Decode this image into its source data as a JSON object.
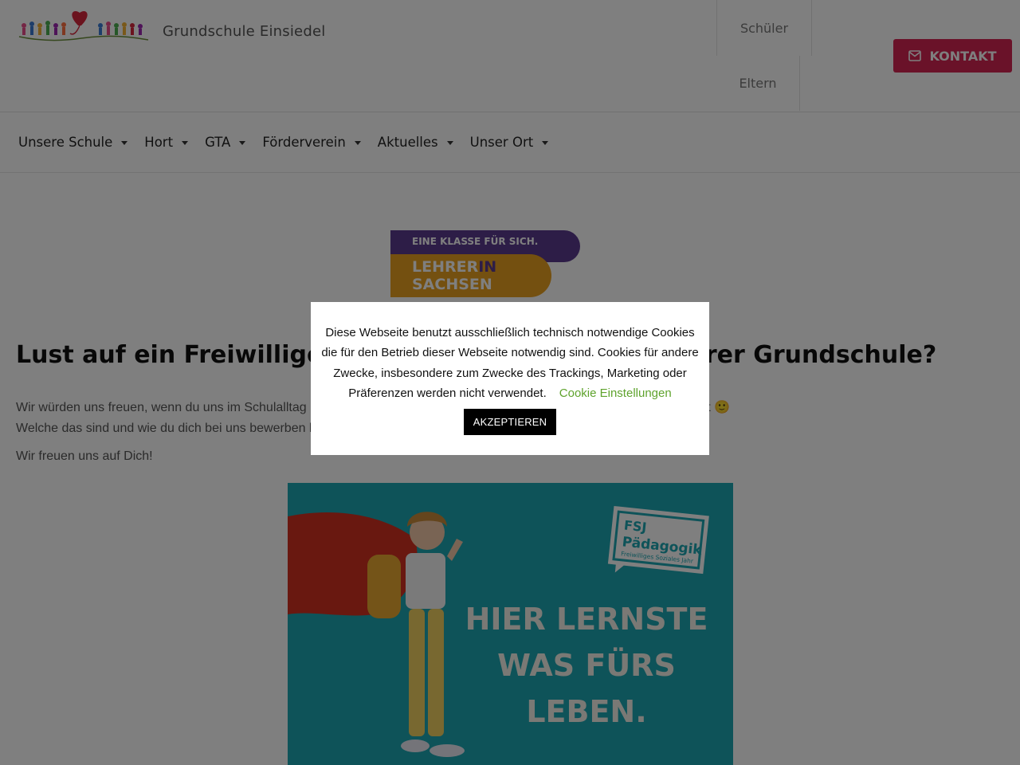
{
  "header": {
    "site_title": "Grundschule Einsiedel",
    "top_links": {
      "schueler": "Schüler",
      "eltern": "Eltern"
    },
    "kontakt_label": "KONTAKT"
  },
  "nav": {
    "items": [
      "Unsere Schule",
      "Hort",
      "GTA",
      "Förderverein",
      "Aktuelles",
      "Unser Ort"
    ]
  },
  "banner": {
    "line1": "EINE KLASSE FÜR SICH.",
    "line2a": "LEHRER",
    "line2b": "IN",
    "line3": "SACHSEN"
  },
  "content": {
    "headline": "Lust auf ein Freiwilliges Soziales Jahr (FSJ) an unserer Grundschule?",
    "para1_line1": "Wir würden uns freuen, wenn du uns im Schulalltag unterstützt. Es gibt verschiedene Aufgaben, die du übernehmen kannst 🙂",
    "para1_line2": "Welche das sind und wie du dich bei uns bewerben kannst, erfährst du unten.",
    "para2": "Wir freuen uns auf Dich!"
  },
  "poster": {
    "badge_line1": "FSJ",
    "badge_line2": "Pädagogik",
    "badge_line3": "Freiwilliges Soziales Jahr",
    "slogan_line1": "HIER LERNSTE",
    "slogan_line2": "WAS FÜRS",
    "slogan_line3": "LEBEN."
  },
  "cookie": {
    "text": "Diese Webseite benutzt ausschließlich technisch notwendige Cookies die für den Betrieb dieser Webseite notwendig sind. Cookies für andere Zwecke, insbesondere zum Zwecke des Trackings, Marketing oder Präferenzen werden nicht verwendet.",
    "settings_link": "Cookie Einstellungen",
    "accept_label": "AKZEPTIEREN"
  },
  "colors": {
    "kontakt_bg": "#d52553",
    "banner_purple": "#5b3a8e",
    "banner_orange": "#e8a020",
    "poster_bg": "#1ca6b2",
    "cookie_link": "#5fa32d"
  },
  "icons": {
    "kontakt": "envelope-icon",
    "nav_caret": "caret-down-icon"
  }
}
